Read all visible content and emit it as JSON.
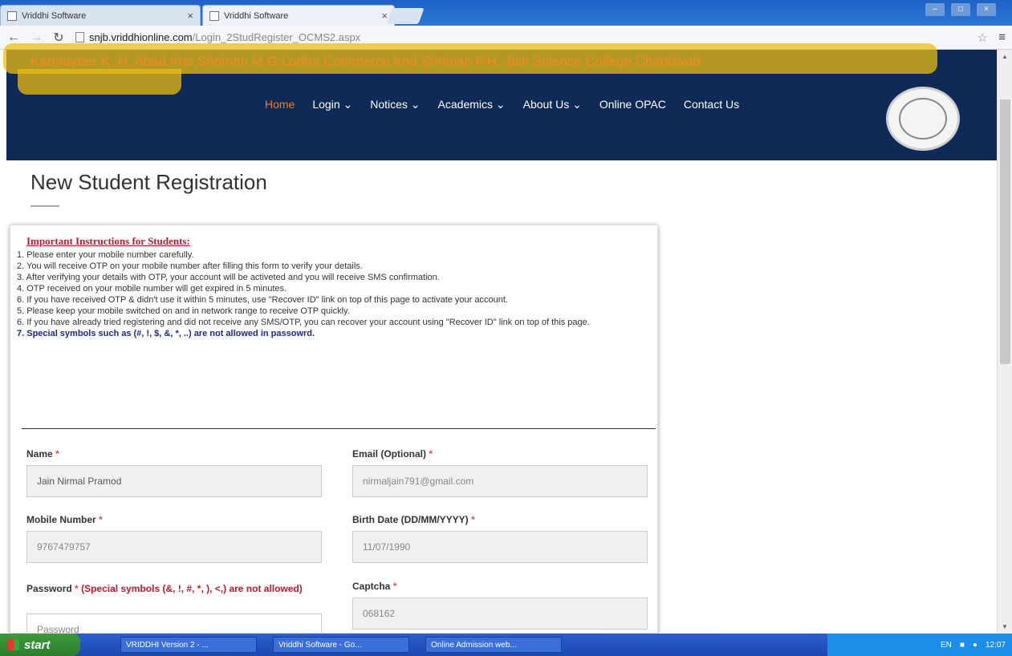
{
  "browser": {
    "tabs": [
      {
        "label": "Vriddhi Software"
      },
      {
        "label": "Vriddhi Software"
      }
    ],
    "url_host": "snjb.vriddhionline.com",
    "url_path": "/Login_2StudRegister_OCMS2.aspx"
  },
  "header": {
    "college_name": "Karmaveer K. H. Abad Arts,Shriman M.G.Lodha Commerce And Shriman P.H. Jain Science College Chandwad",
    "nav": [
      {
        "label": "Home"
      },
      {
        "label": "Login ⌄"
      },
      {
        "label": "Notices ⌄"
      },
      {
        "label": "Academics ⌄"
      },
      {
        "label": "About Us ⌄"
      },
      {
        "label": "Online OPAC"
      },
      {
        "label": "Contact Us"
      }
    ]
  },
  "page": {
    "title": "New Student Registration"
  },
  "instructions": {
    "title": "Important Instructions for Students:",
    "items": [
      "1. Please enter your mobile number carefully.",
      "2. You will receive OTP on your mobile number after filling this form to verify your details.",
      "3. After verifying your details with OTP, your account will be activeted and you will receive SMS confirmation.",
      "4. OTP received on your mobile number will get expired in 5 minutes.",
      "6. If you have received OTP & didn't use it within 5 minutes, use \"Recover ID\" link on top of this page to activate your account.",
      "5. Please keep your mobile switched on and in network range to receive OTP quickly.",
      "6. If you have already tried registering and did not receive any SMS/OTP, you can recover your account using \"Recover ID\" link on top of this page.",
      "7. Special symbols such as (#, !, $, &, *, ..) are not allowed in passowrd."
    ]
  },
  "form": {
    "name_label": "Name",
    "name_value": "Jain Nirmal Pramod",
    "email_label": "Email (Optional)",
    "email_value": "nirmaljain791@gmail.com",
    "mobile_label": "Mobile Number",
    "mobile_value": "9767479757",
    "birth_label": "Birth Date (DD/MM/YYYY)",
    "birth_value": "11/07/1990",
    "password_label": "Password",
    "password_warning": "(Special symbols (&, !, #, *, ), <,) are not allowed)",
    "password_placeholder": "Password",
    "captcha_label": "Captcha",
    "captcha_value": "068162",
    "required_mark": "*"
  },
  "taskbar": {
    "start_label": "start",
    "tasks": [
      {
        "label": "VRIDDHI Version 2 - ..."
      },
      {
        "label": "Vriddhi Software - Go..."
      },
      {
        "label": "Online Admission web..."
      }
    ],
    "lang": "EN",
    "time": "12:07"
  }
}
